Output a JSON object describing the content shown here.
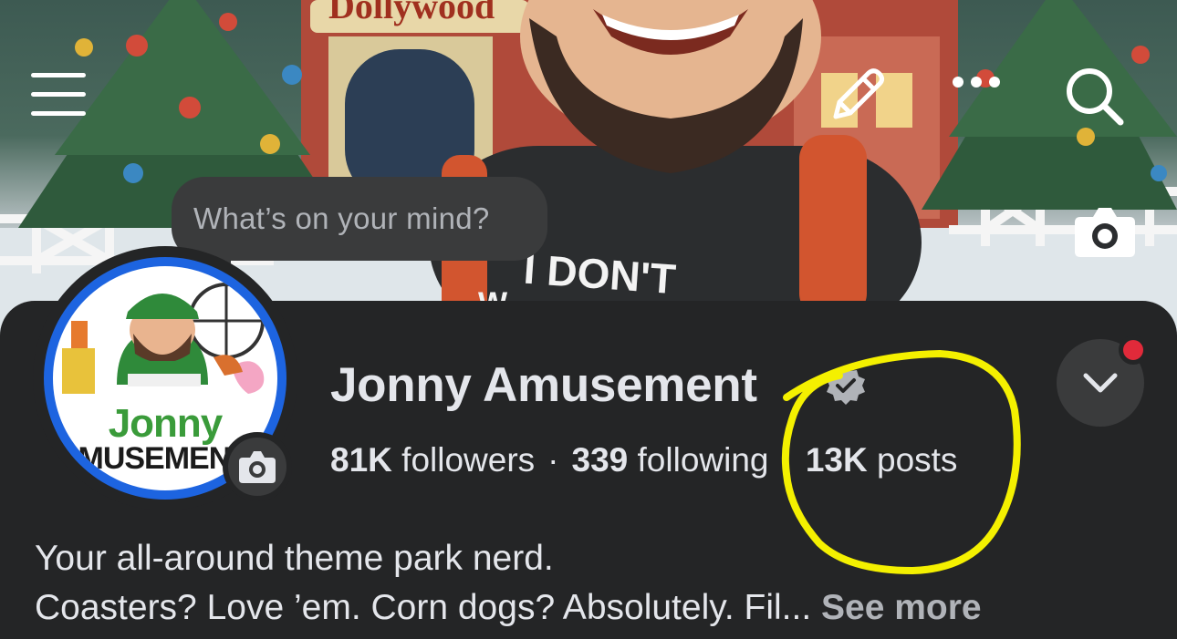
{
  "cover": {
    "sign_text": "Dollywood",
    "shirt_text": "I DON'T",
    "shirt_text_2": "W"
  },
  "topbar": {
    "menu_icon": "hamburger-menu-icon",
    "edit_icon": "pencil-icon",
    "more_icon": "ellipsis-icon",
    "search_icon": "search-icon",
    "cover_camera_icon": "camera-icon"
  },
  "composer": {
    "placeholder": "What’s on your mind?"
  },
  "avatar": {
    "text_line1": "Jonny",
    "text_line2": "AMUSEMENT"
  },
  "profile": {
    "name": "Jonny Amusement",
    "verified": true,
    "stats": {
      "followers_count": "81K",
      "followers_label": "followers",
      "following_count": "339",
      "following_label": "following",
      "posts_count": "13K",
      "posts_label": "posts",
      "separator": "·"
    },
    "bio_line1": "Your all-around theme park nerd.",
    "bio_line2": "Coasters? Love ’em. Corn dogs? Absolutely. Fil...",
    "see_more": "See more"
  },
  "colors": {
    "background": "#242526",
    "surface": "#3a3b3c",
    "text_primary": "#e4e6eb",
    "text_secondary": "#b0b3b8",
    "avatar_ring": "#1d64e0",
    "notification": "#e02a3a",
    "annotation": "#f4f000"
  }
}
